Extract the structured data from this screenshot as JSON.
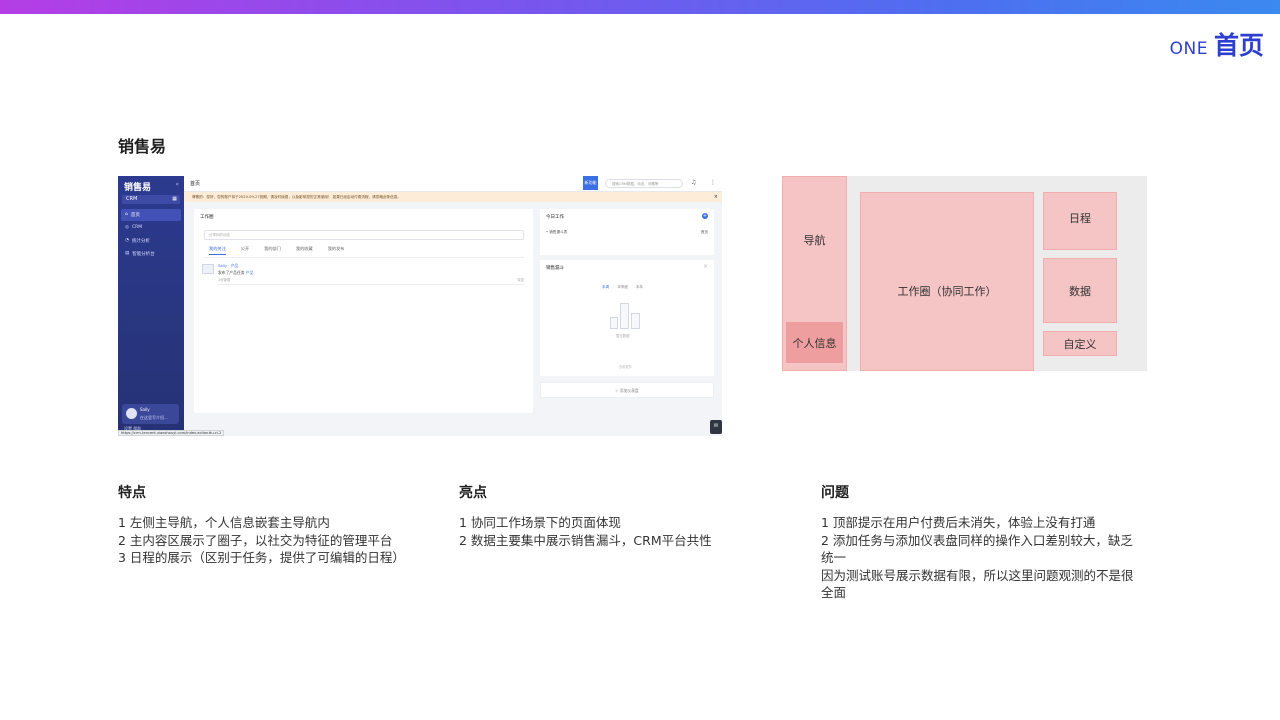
{
  "brand": {
    "prefix": "ONE",
    "title": "首页"
  },
  "section_title": "销售易",
  "shot": {
    "logo": "销售易",
    "crm_selector": "CRM",
    "menu": [
      "首页",
      "CRM",
      "统计分析",
      "智能分析台"
    ],
    "user_name": "Sally",
    "user_desc": "在这里写介绍...",
    "footer": "设置   帮助",
    "header_title": "首页",
    "new_button": "新功能",
    "search_placeholder": "搜索CRM数据、动态、问题等",
    "notice": "尊敬的：您好，您的账户将于2020-09-27到期，请及时续费，以免影响您的正常使用！ 如果已经启动付费流程，请忽略此条信息。",
    "work_title": "工作圈",
    "work_input_placeholder": "分享你的动态",
    "work_tabs": [
      "我的关注",
      "公开",
      "我的部门",
      "我的收藏",
      "我的发布"
    ],
    "post_name": "Sally",
    "post_tag": "产品",
    "post_text": "发布了产品任务",
    "post_link": "产品",
    "post_meta": "1分钟前",
    "post_comment": "评论",
    "today_title": "今日工作",
    "today_item": "销售漏斗表",
    "today_item_right": "首页",
    "funnel_title": "销售漏斗",
    "funnel_tabs": [
      "本周",
      "本季度",
      "本年"
    ],
    "funnel_empty": "暂无数据",
    "funnel_footer": "查看更多",
    "add_board": "添加仪表盘",
    "url": "https://crm-tencent.xiaoshouyi.com/index.action#u-ci-2"
  },
  "wireframe": {
    "nav": "导航",
    "personal_info": "个人信息",
    "work_circle": "工作圈（协同工作）",
    "schedule": "日程",
    "data": "数据",
    "custom": "自定义"
  },
  "features": {
    "title": "特点",
    "lines": [
      "1 左侧主导航，个人信息嵌套主导航内",
      "2 主内容区展示了圈子，以社交为特征的管理平台",
      "3 日程的展示（区别于任务，提供了可编辑的日程）"
    ]
  },
  "highlights": {
    "title": "亮点",
    "lines": [
      "1 协同工作场景下的页面体现",
      "2 数据主要集中展示销售漏斗，CRM平台共性"
    ]
  },
  "issues": {
    "title": "问题",
    "lines": [
      "1 顶部提示在用户付费后未消失，体验上没有打通",
      "2 添加任务与添加仪表盘同样的操作入口差别较大，缺乏统一",
      "因为测试账号展示数据有限，所以这里问题观测的不是很全面"
    ]
  }
}
